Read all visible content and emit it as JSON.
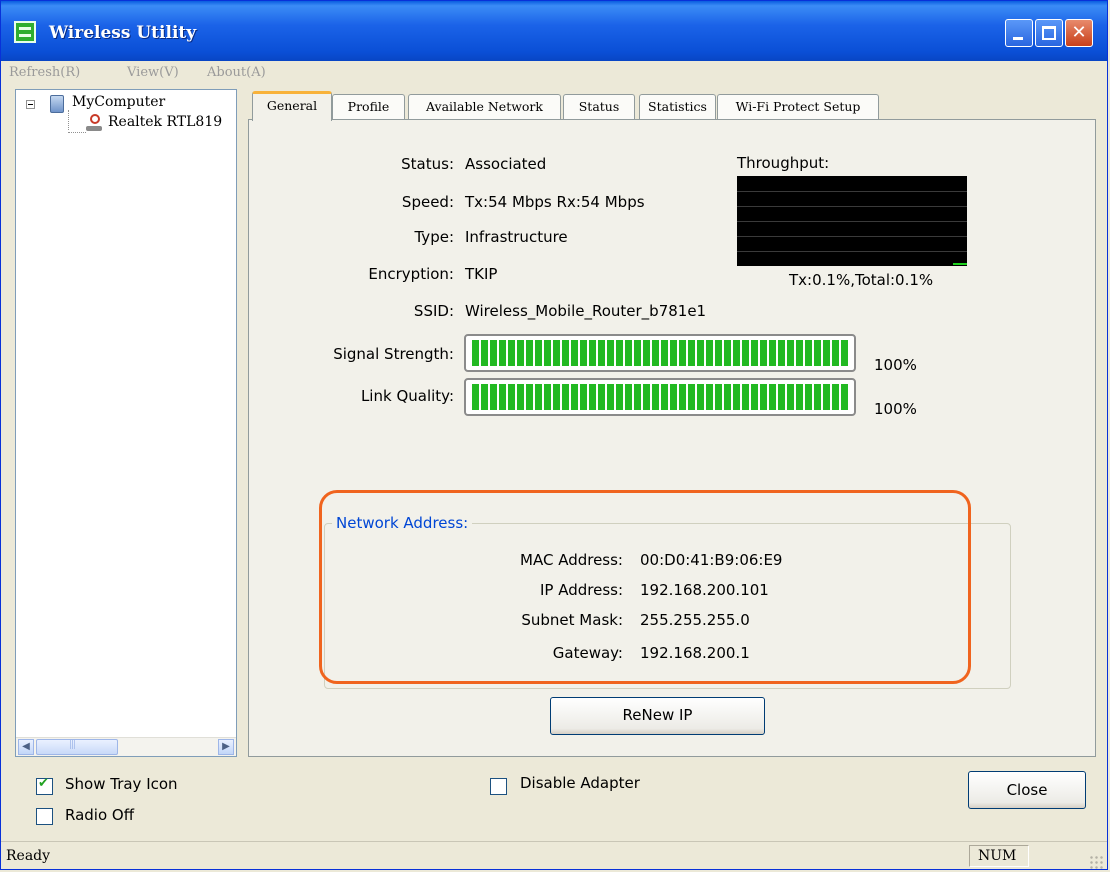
{
  "window": {
    "title": "Wireless Utility"
  },
  "menu": {
    "items": [
      {
        "label": "Refresh(R)"
      },
      {
        "label": "View(V)"
      },
      {
        "label": "About(A)"
      }
    ]
  },
  "tree": {
    "root": "MyComputer",
    "child": "Realtek RTL819"
  },
  "tabs": [
    {
      "label": "General"
    },
    {
      "label": "Profile"
    },
    {
      "label": "Available Network"
    },
    {
      "label": "Status"
    },
    {
      "label": "Statistics"
    },
    {
      "label": "Wi-Fi Protect Setup"
    }
  ],
  "general": {
    "status_label": "Status:",
    "status": "Associated",
    "speed_label": "Speed:",
    "speed": "Tx:54 Mbps Rx:54 Mbps",
    "type_label": "Type:",
    "type": "Infrastructure",
    "encryption_label": "Encryption:",
    "encryption": "TKIP",
    "ssid_label": "SSID:",
    "ssid": "Wireless_Mobile_Router_b781e1",
    "throughput_label": "Throughput:",
    "throughput_value": "Tx:0.1%,Total:0.1%",
    "signal_label": "Signal Strength:",
    "signal_value": "100%",
    "signal_fraction": 1.0,
    "link_label": "Link Quality:",
    "link_value": "100%",
    "link_fraction": 1.0
  },
  "network_address": {
    "title": "Network Address:",
    "mac_label": "MAC Address:",
    "mac": "00:D0:41:B9:06:E9",
    "ip_label": "IP Address:",
    "ip": "192.168.200.101",
    "subnet_label": "Subnet Mask:",
    "subnet": "255.255.255.0",
    "gateway_label": "Gateway:",
    "gateway": "192.168.200.1"
  },
  "buttons": {
    "renew": "ReNew IP",
    "close": "Close"
  },
  "options": {
    "show_tray": {
      "label": "Show Tray Icon",
      "checked": true
    },
    "radio_off": {
      "label": "Radio Off",
      "checked": false
    },
    "disable_adapter": {
      "label": "Disable Adapter",
      "checked": false
    }
  },
  "statusbar": {
    "text": "Ready",
    "num": "NUM"
  },
  "colors": {
    "highlight": "#f0641e",
    "bar_fill": "#22b922",
    "group_title": "#0046d5",
    "titlebar": "#0a4fd6"
  }
}
